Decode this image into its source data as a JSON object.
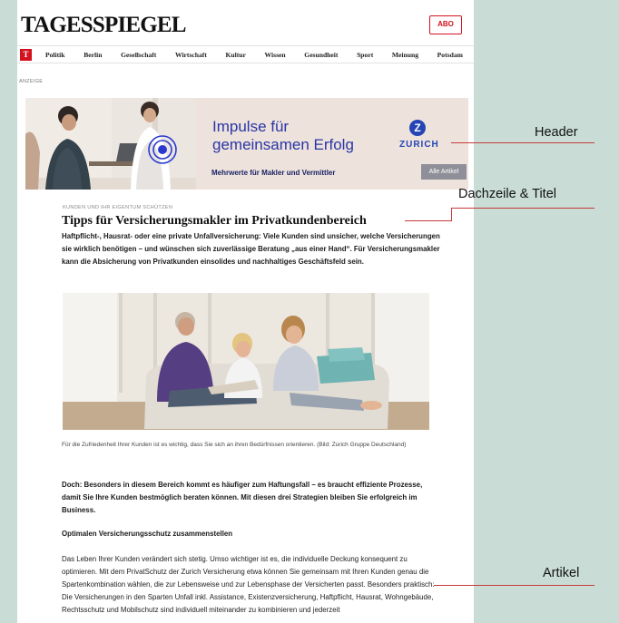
{
  "site": {
    "logo": "TAGESSPIEGEL",
    "abo_label": "ABO",
    "nav_badge": "T",
    "nav": [
      "Politik",
      "Berlin",
      "Gesellschaft",
      "Wirtschaft",
      "Kultur",
      "Wissen",
      "Gesundheit",
      "Sport",
      "Meinung",
      "Potsdam"
    ]
  },
  "ad": {
    "label": "ANZEIGE",
    "title_line1": "Impulse für",
    "title_line2": "gemeinsamen Erfolg",
    "subtitle": "Mehrwerte für Makler und Vermittler",
    "brand": "ZURICH",
    "brand_mark": "Z",
    "button_label": "Alle Artikel"
  },
  "article": {
    "kicker": "KUNDEN UND IHR EIGENTUM SCHÜTZEN",
    "headline": "Tipps für Versicherungsmakler im Privatkundenbereich",
    "lead": "Haftpflicht-, Hausrat- oder eine private Unfallversicherung: Viele Kunden sind unsicher, welche Versicherungen sie wirklich benötigen – und wünschen sich zuverlässige Beratung „aus einer Hand“. Für Versicherungsmakler kann die Absicherung von Privatkunden einsolides und nachhaltiges Geschäftsfeld sein.",
    "caption": "Für die Zufriedenheit Ihrer Kunden ist es wichtig, dass Sie sich an ihren Bedürfnissen orientieren. (Bild: Zurich Gruppe Deutschland)",
    "intro": "Doch: Besonders in diesem Bereich kommt es häufiger zum Haftungsfall – es braucht effiziente Prozesse, damit Sie Ihre Kunden bestmöglich beraten können. Mit diesen drei Strategien bleiben Sie erfolgreich im Business.",
    "subhead": "Optimalen Versicherungsschutz zusammenstellen",
    "body": "Das Leben Ihrer Kunden verändert sich stetig. Umso wichtiger ist es, die individuelle Deckung konsequent zu optimieren. Mit dem PrivatSchutz der Zurich Versicherung etwa können Sie gemeinsam mit Ihren Kunden genau die Spartenkombination wählen, die zur Lebensweise und zur Lebensphase der Versicherten passt. Besonders praktisch: Die Versicherungen in den Sparten Unfall inkl. Assistance, Existenzversicherung, Haftpflicht, Hausrat, Wohngebäude, Rechtsschutz und Mobilschutz sind individuell miteinander zu kombinieren und jederzeit"
  },
  "callouts": {
    "header": "Header",
    "title": "Dachzeile & Titel",
    "article": "Artikel"
  },
  "colors": {
    "background": "#c9ddd6",
    "brand_red": "#d4121f",
    "zurich_blue": "#2545b5",
    "callout_line": "#c63a3a"
  }
}
